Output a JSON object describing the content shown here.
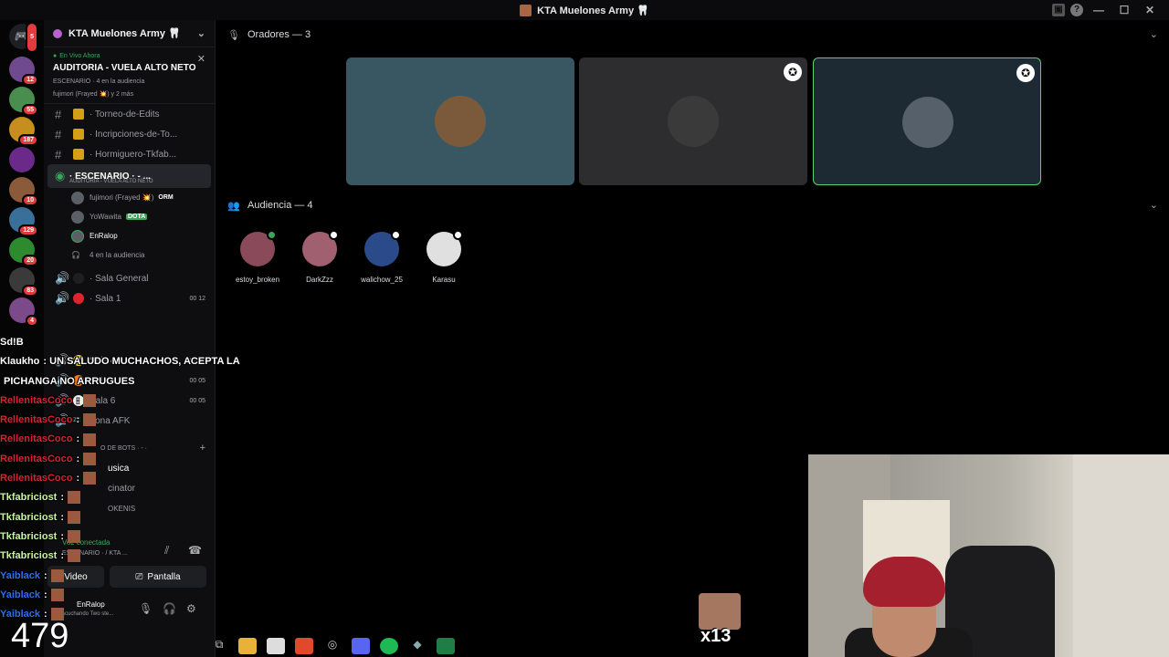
{
  "window": {
    "title": "KTA Muelones Army 🦷"
  },
  "guilds": [
    {
      "badge": "5",
      "color": "#5865f2"
    },
    {
      "badge": "12",
      "color": "#6f4a8e"
    },
    {
      "badge": "55",
      "color": "#4a8e4f"
    },
    {
      "badge": "187",
      "color": "#c68d1f"
    },
    {
      "badge": "",
      "color": "#6b2a8a"
    },
    {
      "badge": "10",
      "color": "#8a5a3a"
    },
    {
      "badge": "129",
      "color": "#3a6f9a"
    },
    {
      "badge": "20",
      "color": "#2e8a2e"
    },
    {
      "badge": "83",
      "color": "#3a3a3a"
    },
    {
      "badge": "4",
      "color": "#7a4a8a"
    }
  ],
  "server": {
    "name": "KTA Muelones Army 🦷",
    "live": {
      "label": "En Vivo Ahora",
      "title": "AUDITORIA - VUELA ALTO NETO",
      "meta": "ESCENARIO · 4 en la audiencia",
      "speakers": "fujimori (Frayed 💥) y 2 más"
    },
    "channels": [
      {
        "name": "· Torneo-de-Edits",
        "type": "text",
        "emoji_color": "#d4a017"
      },
      {
        "name": "· Incripciones-de-To...",
        "type": "text",
        "emoji_color": "#d4a017"
      },
      {
        "name": "· Hormiguero-Tkfab...",
        "type": "text",
        "emoji_color": "#d4a017"
      }
    ],
    "stage": {
      "name": "· ESCENARIO · - ...",
      "sub": "AUDITORIA - VUELA ALTO NETO",
      "members": [
        {
          "name": "fujimori (Frayed 💥)",
          "tag": "ORM"
        },
        {
          "name": "YoWawita",
          "tag": "DOTA"
        },
        {
          "name": "EnRalop",
          "tag": ""
        }
      ],
      "audience": "4 en la audiencia"
    },
    "voice": [
      {
        "name": "· Sala General",
        "dot": "#1f1f1f",
        "count": ""
      },
      {
        "name": "· Sala 1",
        "dot": "#e0242f",
        "count": "00 12"
      },
      {
        "name": "Sala 4",
        "dot": "#f2d21b",
        "count": "00 05"
      },
      {
        "name": "Sala 5",
        "dot": "#f07b1f",
        "count": "00 05"
      },
      {
        "name": "Sala 6",
        "dot": "#eeeeee",
        "count": "00 05"
      },
      {
        "name": "Zona AFK",
        "dot": "",
        "count": ""
      }
    ],
    "bots_category": "O DE BOTS · - ·",
    "bot_channels": [
      "usica",
      "cinator",
      "OKENIS"
    ]
  },
  "voice_panel": {
    "status": "Voz conectada",
    "location": "ESCENARIO · / KTA ...",
    "video": "Video",
    "screen": "Pantalla"
  },
  "user": {
    "name": "EnRalop",
    "status": "Escuchando Two ste..."
  },
  "stage_main": {
    "speakers_header": "Oradores — 3",
    "audience_header": "Audiencia — 4",
    "speaker_tiles": [
      {
        "bg": "#395763",
        "border": "none",
        "mod": false,
        "avatar": "#7a5a3a"
      },
      {
        "bg": "#2d2d2f",
        "border": "none",
        "mod": true,
        "avatar": "#3a3a3a"
      },
      {
        "bg": "#1e2a33",
        "border": "#5ad16e",
        "mod": true,
        "avatar": "#55606a"
      }
    ],
    "audience": [
      {
        "name": "estoy_broken",
        "color": "#8a4a5a"
      },
      {
        "name": "DarkZzz",
        "color": "#a06070"
      },
      {
        "name": "walichow_25",
        "color": "#2a4a8a"
      },
      {
        "name": "Karasu",
        "color": "#e0e0e0"
      }
    ]
  },
  "overlay": {
    "chat": [
      {
        "user": "Sd!B",
        "color": "#ffffff",
        "msg": ""
      },
      {
        "user": "Klaukho",
        "color": "#ffffff",
        "msg": ": UN SALUDO MUCHACHOS, ACEPTA LA"
      },
      {
        "user": "",
        "color": "#ffffff",
        "msg": "PICHANGA NO ARRUGUES"
      },
      {
        "user": "RellenitasCoco",
        "color": "#d82233",
        "msg": ":"
      },
      {
        "user": "RellenitasCoco",
        "color": "#d82233",
        "msg": ":"
      },
      {
        "user": "RellenitasCoco",
        "color": "#d82233",
        "msg": ":"
      },
      {
        "user": "RellenitasCoco",
        "color": "#d82233",
        "msg": ":"
      },
      {
        "user": "RellenitasCoco",
        "color": "#d82233",
        "msg": ":"
      },
      {
        "user": "Tkfabriciost",
        "color": "#c6f5a0",
        "msg": ":"
      },
      {
        "user": "Tkfabriciost",
        "color": "#c6f5a0",
        "msg": ":"
      },
      {
        "user": "Tkfabriciost",
        "color": "#c6f5a0",
        "msg": ":"
      },
      {
        "user": "Tkfabriciost",
        "color": "#c6f5a0",
        "msg": ":"
      },
      {
        "user": "Yaiblack",
        "color": "#2b6ff0",
        "msg": ":"
      },
      {
        "user": "Yaiblack",
        "color": "#2b6ff0",
        "msg": ":"
      },
      {
        "user": "Yaiblack",
        "color": "#2b6ff0",
        "msg": ":"
      }
    ],
    "counter": "479",
    "combo": "x13"
  }
}
